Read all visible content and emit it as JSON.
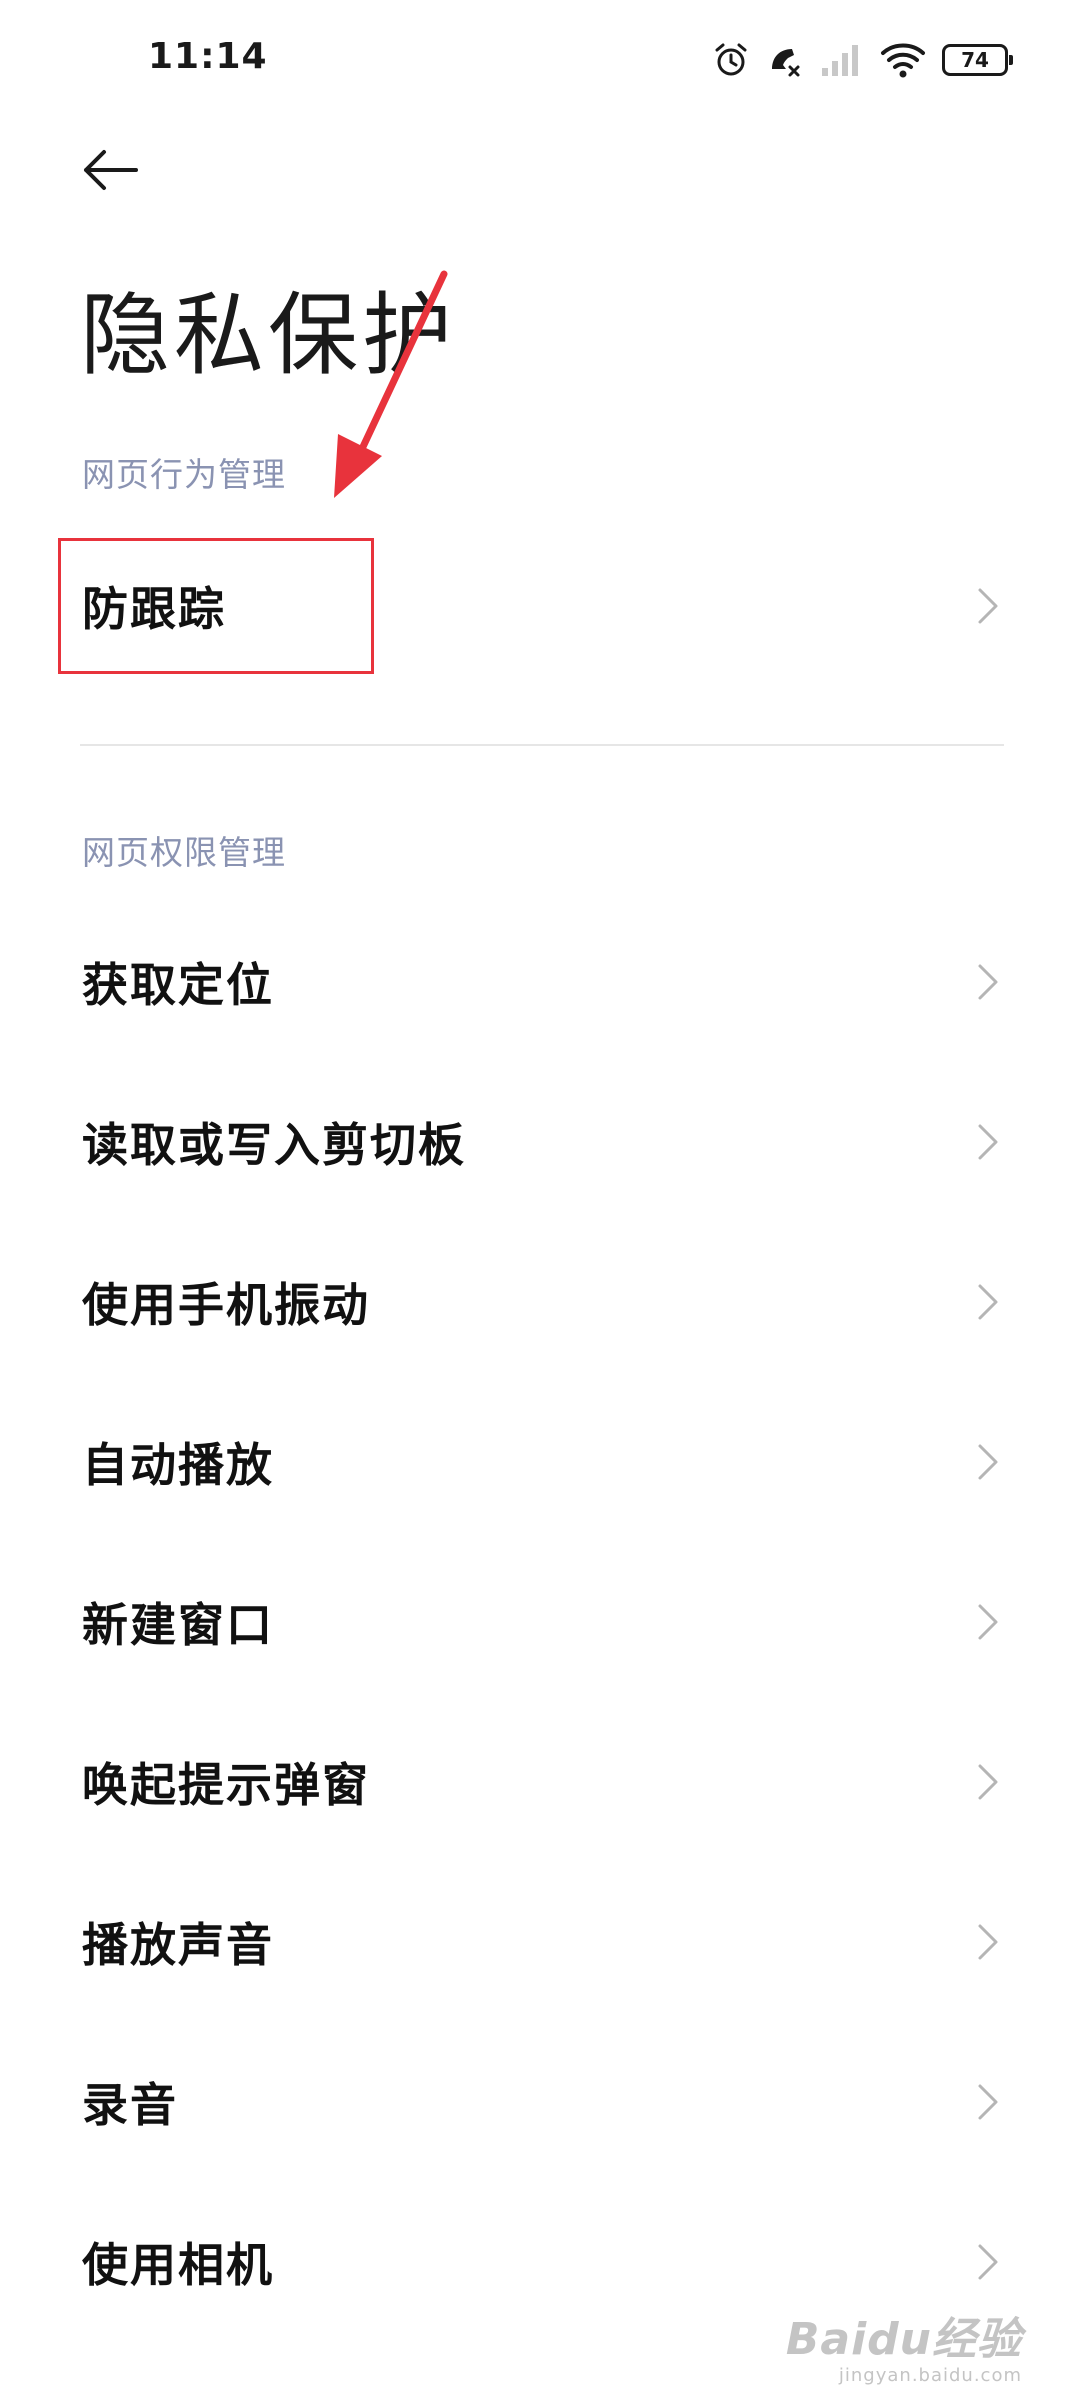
{
  "status_bar": {
    "time": "11:14",
    "battery": "74",
    "icons": [
      "alarm-icon",
      "call-muted-icon",
      "signal-icon",
      "wifi-icon",
      "battery-icon"
    ]
  },
  "header": {
    "back_icon": "arrow-left-icon",
    "title": "隐私保护"
  },
  "sections": [
    {
      "title": "网页行为管理",
      "items": [
        {
          "label": "防跟踪"
        }
      ]
    },
    {
      "title": "网页权限管理",
      "items": [
        {
          "label": "获取定位"
        },
        {
          "label": "读取或写入剪切板"
        },
        {
          "label": "使用手机振动"
        },
        {
          "label": "自动播放"
        },
        {
          "label": "新建窗口"
        },
        {
          "label": "唤起提示弹窗"
        },
        {
          "label": "播放声音"
        },
        {
          "label": "录音"
        },
        {
          "label": "使用相机"
        }
      ]
    }
  ],
  "annotation": {
    "color": "#e8333c"
  },
  "watermark": {
    "logo": "Baidu经验",
    "domain": "jingyan.baidu.com"
  },
  "colors": {
    "section_header": "#8a93b2",
    "chevron": "#b5b5b5",
    "annotation": "#e8333c"
  }
}
